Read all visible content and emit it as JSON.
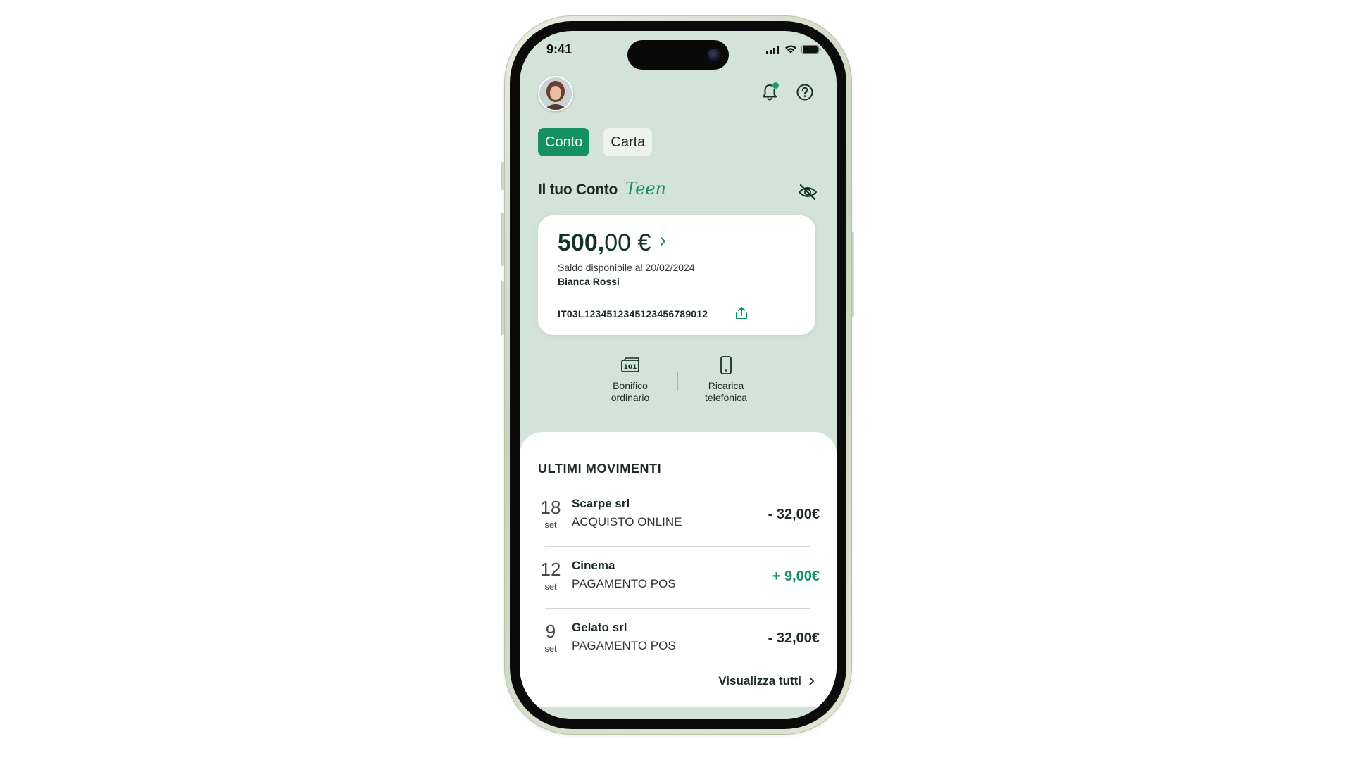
{
  "status_bar": {
    "time": "9:41"
  },
  "tabs": [
    {
      "label": "Conto",
      "active": true
    },
    {
      "label": "Carta",
      "active": false
    }
  ],
  "section": {
    "title": "Il tuo Conto",
    "script_label": "Teen"
  },
  "balance": {
    "amount_int": "500,",
    "amount_dec": "00 €",
    "subtitle": "Saldo disponibile al 20/02/2024",
    "owner": "Bianca Rossi",
    "iban": "IT03L1234512345123456789012"
  },
  "actions": [
    {
      "line1": "Bonifico",
      "line2": "ordinario",
      "icon": "banknote-icon"
    },
    {
      "line1": "Ricarica",
      "line2": "telefonica",
      "icon": "phone-icon"
    }
  ],
  "movements": {
    "title": "ULTIMI MOVIMENTI",
    "items": [
      {
        "day": "18",
        "month": "set",
        "name": "Scarpe srl",
        "type": "ACQUISTO ONLINE",
        "amount": "- 32,00€",
        "positive": false
      },
      {
        "day": "12",
        "month": "set",
        "name": "Cinema",
        "type": "PAGAMENTO POS",
        "amount": "+ 9,00€",
        "positive": true
      },
      {
        "day": "9",
        "month": "set",
        "name": "Gelato srl",
        "type": "PAGAMENTO POS",
        "amount": "- 32,00€",
        "positive": false
      }
    ],
    "view_all": "Visualizza tutti"
  },
  "colors": {
    "accent": "#159060",
    "screen_bg": "#d3e3d9",
    "dark_text": "#1c2a24"
  }
}
